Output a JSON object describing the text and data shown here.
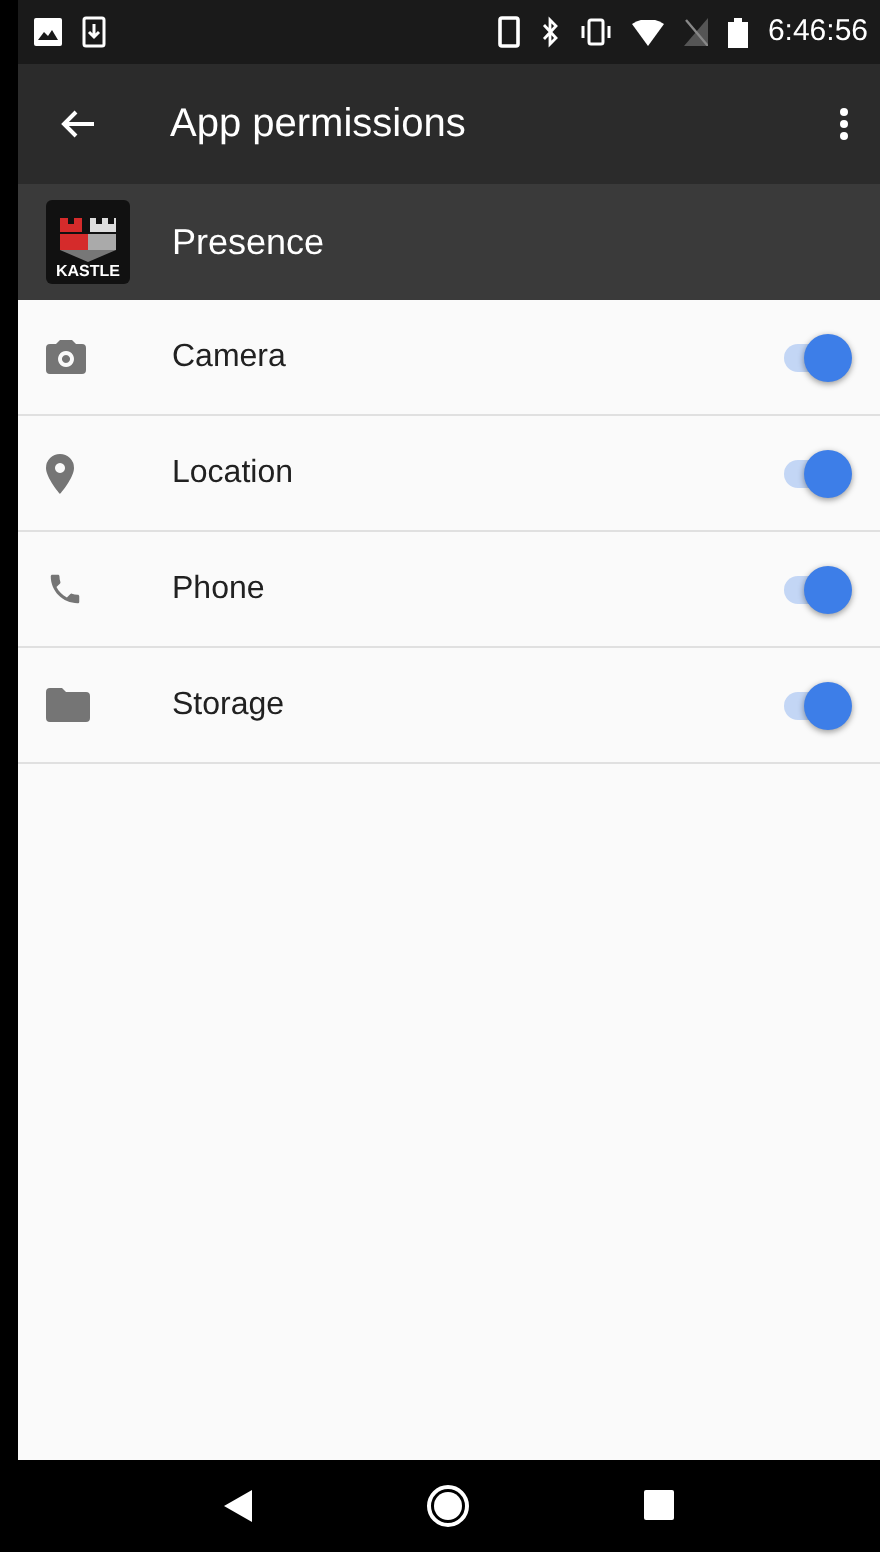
{
  "status_bar": {
    "time": "6:46:56"
  },
  "toolbar": {
    "title": "App permissions"
  },
  "app": {
    "name": "Presence",
    "icon_label": "KASTLE"
  },
  "permissions": [
    {
      "label": "Camera",
      "on": true
    },
    {
      "label": "Location",
      "on": true
    },
    {
      "label": "Phone",
      "on": true
    },
    {
      "label": "Storage",
      "on": true
    }
  ]
}
